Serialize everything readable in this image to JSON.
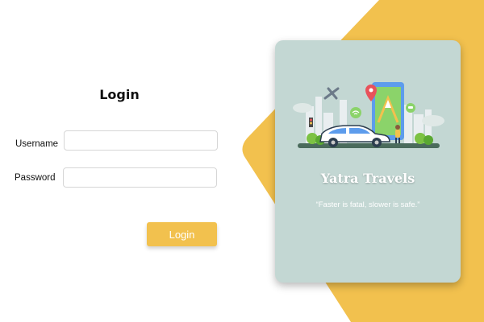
{
  "login": {
    "title": "Login",
    "username_label": "Username",
    "password_label": "Password",
    "username_value": "",
    "password_value": "",
    "button_label": "Login"
  },
  "brand": {
    "name": "Yatra Travels",
    "tagline": "“Faster is fatal, slower is safe.”"
  },
  "colors": {
    "accent": "#f2c14e",
    "card": "#c3d7d3",
    "background": "#ffffff"
  }
}
